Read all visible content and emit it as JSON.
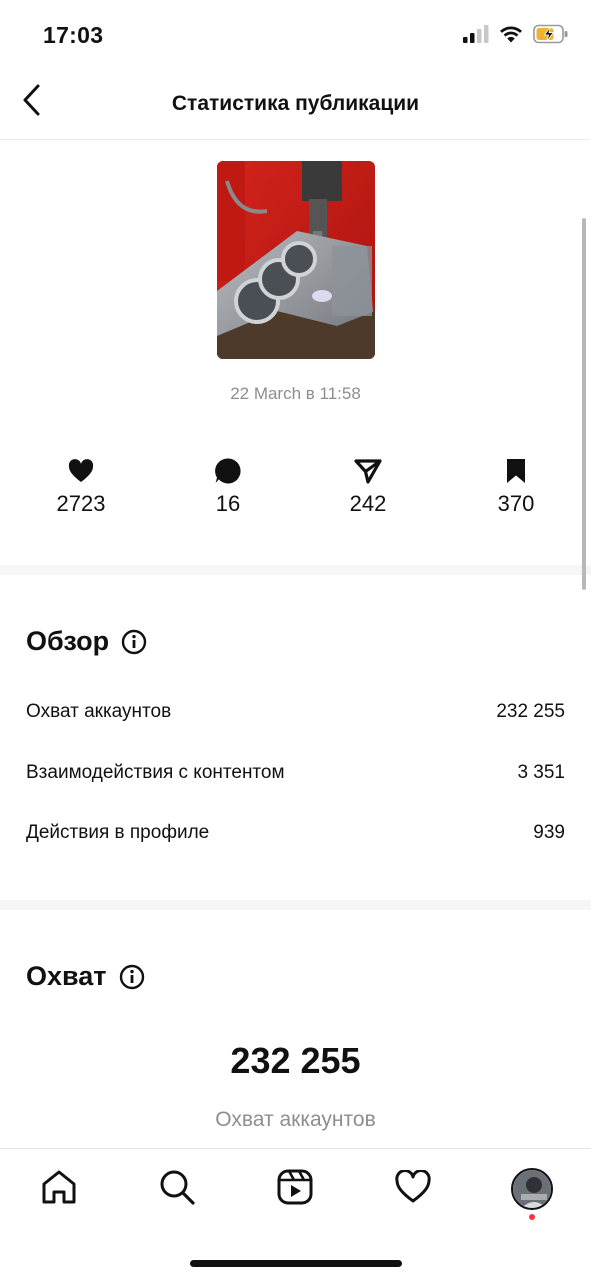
{
  "status": {
    "time": "17:03",
    "icons": [
      "cellular-signal-icon",
      "wifi-icon",
      "battery-charging-icon"
    ]
  },
  "header": {
    "back_icon": "chevron-left-icon",
    "title": "Статистика публикации"
  },
  "post": {
    "thumbnail": "engine-block-photo",
    "date": "22 March в 11:58"
  },
  "metrics": [
    {
      "icon": "heart-icon",
      "value": "2723"
    },
    {
      "icon": "comment-icon",
      "value": "16"
    },
    {
      "icon": "share-icon",
      "value": "242"
    },
    {
      "icon": "bookmark-icon",
      "value": "370"
    }
  ],
  "overview": {
    "title": "Обзор",
    "rows": [
      {
        "label": "Охват аккаунтов",
        "value": "232 255"
      },
      {
        "label": "Взаимодействия с контентом",
        "value": "3 351"
      },
      {
        "label": "Действия в профиле",
        "value": "939"
      }
    ]
  },
  "reach": {
    "title": "Охват",
    "value": "232 255",
    "label": "Охват аккаунтов"
  },
  "bottom_nav": [
    "home-icon",
    "search-icon",
    "reels-icon",
    "activity-heart-icon",
    "profile-avatar"
  ],
  "colors": {
    "text": "#111111",
    "muted": "#8e8e8e",
    "notification_dot": "#ff3040",
    "battery_fill": "#f2b230"
  }
}
